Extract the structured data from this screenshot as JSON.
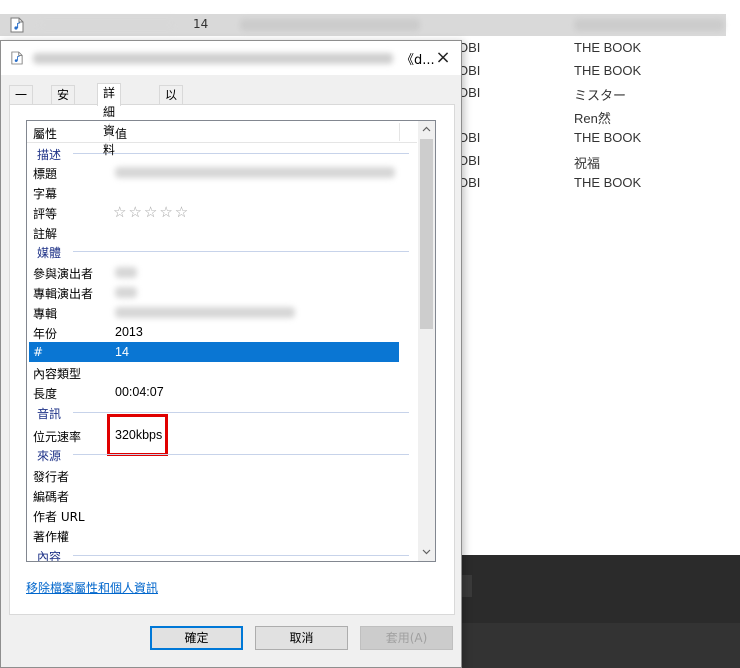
{
  "background": {
    "first_row_number": "14",
    "rows": [
      {
        "col3": "OBI",
        "col4": "THE BOOK"
      },
      {
        "col3": "OBI",
        "col4": "THE BOOK"
      },
      {
        "col3": "OBI",
        "col4": "ミスター"
      },
      {
        "col3": "",
        "col4": "Ren然"
      },
      {
        "col3": "OBI",
        "col4": "THE BOOK"
      },
      {
        "col3": "OBI",
        "col4": "祝福"
      },
      {
        "col3": "OBI",
        "col4": "THE BOOK"
      }
    ]
  },
  "dialog": {
    "title_suffix": "《d...",
    "close_icon": "×",
    "tabs": [
      "一般",
      "安全性",
      "詳細資料",
      "以前的版本"
    ],
    "active_tab": 2,
    "list": {
      "header_name": "屬性",
      "header_value": "值",
      "groups": {
        "description": "描述",
        "media": "媒體",
        "audio": "音訊",
        "source": "來源",
        "content": "內容"
      },
      "rows": {
        "title": {
          "name": "標題"
        },
        "subtitle": {
          "name": "字幕"
        },
        "rating": {
          "name": "評等",
          "stars": "☆☆☆☆☆"
        },
        "comments": {
          "name": "註解"
        },
        "contributing_artists": {
          "name": "參與演出者"
        },
        "album_artist": {
          "name": "專輯演出者"
        },
        "album": {
          "name": "專輯"
        },
        "year": {
          "name": "年份",
          "value": "2013"
        },
        "track": {
          "name": "#",
          "value": "14"
        },
        "genre": {
          "name": "內容類型"
        },
        "length": {
          "name": "長度",
          "value": "00:04:07"
        },
        "bitrate": {
          "name": "位元速率",
          "value": "320kbps"
        },
        "publisher": {
          "name": "發行者"
        },
        "encoded_by": {
          "name": "編碼者"
        },
        "author_url": {
          "name": "作者 URL"
        },
        "copyright": {
          "name": "著作權"
        }
      }
    },
    "remove_link": "移除檔案屬性和個人資訊",
    "buttons": {
      "ok": "確定",
      "cancel": "取消",
      "apply": "套用(A)"
    },
    "colors": {
      "selection": "#0a76d3",
      "highlight_box": "#e00000",
      "link": "#0066cc"
    }
  }
}
